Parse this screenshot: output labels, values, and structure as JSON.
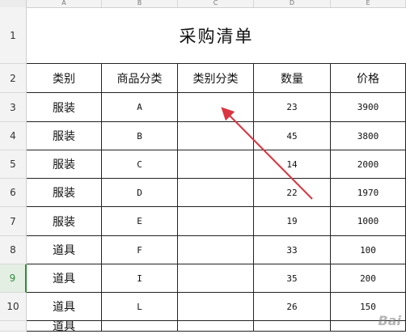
{
  "columns": [
    "A",
    "B",
    "C",
    "D",
    "E"
  ],
  "row_numbers": [
    "1",
    "2",
    "3",
    "4",
    "5",
    "6",
    "7",
    "8",
    "9",
    "10",
    ""
  ],
  "selected_row": "9",
  "title": "采购清单",
  "headers": [
    "类别",
    "商品分类",
    "类别分类",
    "数量",
    "价格"
  ],
  "rows": [
    [
      "服装",
      "A",
      "",
      "23",
      "3900"
    ],
    [
      "服装",
      "B",
      "",
      "45",
      "3800"
    ],
    [
      "服装",
      "C",
      "",
      "14",
      "2000"
    ],
    [
      "服装",
      "D",
      "",
      "22",
      "1970"
    ],
    [
      "服装",
      "E",
      "",
      "19",
      "1000"
    ],
    [
      "道具",
      "F",
      "",
      "33",
      "100"
    ],
    [
      "道具",
      "I",
      "",
      "35",
      "200"
    ],
    [
      "道具",
      "L",
      "",
      "26",
      "150"
    ],
    [
      "道具",
      "",
      "",
      "",
      ""
    ]
  ],
  "watermark": "Bai",
  "colors": {
    "arrow": "#d9343f",
    "grid": "#222222",
    "selected_row": "#2f8a3a"
  }
}
